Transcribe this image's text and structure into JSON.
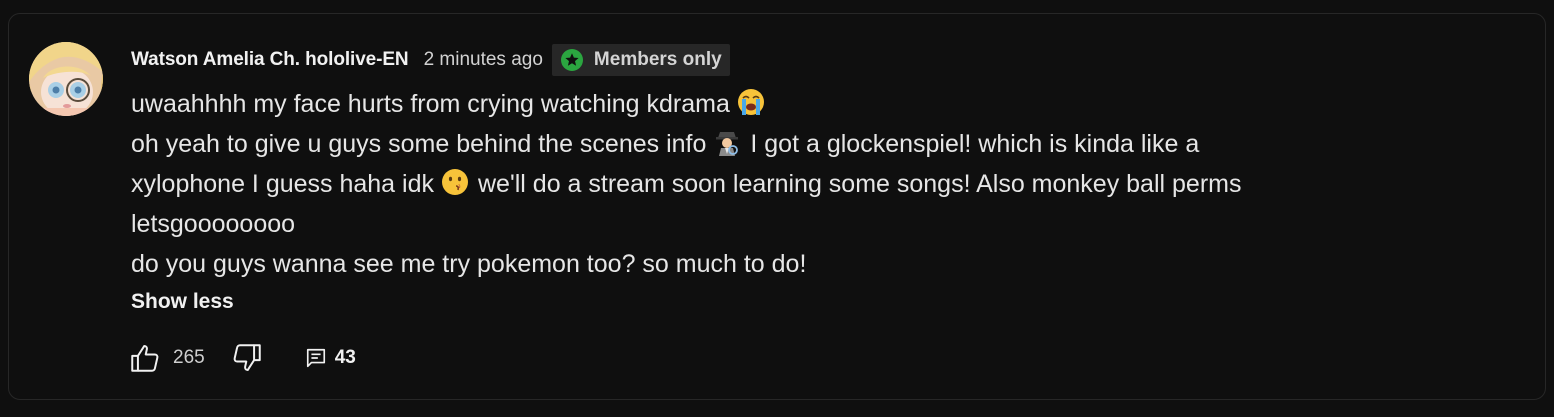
{
  "comment": {
    "author": "Watson Amelia Ch. hololive-EN",
    "timestamp": "2 minutes ago",
    "badge_label": "Members only",
    "badge_icon": "star-icon",
    "accent_color": "#2ba640",
    "lines": {
      "l1": "uwaahhhh my face hurts from crying watching kdrama",
      "l2a": "oh yeah to give u guys some behind the scenes info",
      "l2b": "I got a glockenspiel! which is kinda like a",
      "l3a": "xylophone I guess haha idk",
      "l3b": "we'll do a stream soon learning some songs! Also monkey ball perms",
      "l4": "letsgoooooooo",
      "l5": "do you guys wanna see me try pokemon too? so much to do!"
    },
    "emojis": [
      "loudly-crying-face",
      "detective",
      "shushing-face"
    ],
    "show_less_label": "Show less",
    "like_count": "265",
    "reply_count": "43"
  }
}
